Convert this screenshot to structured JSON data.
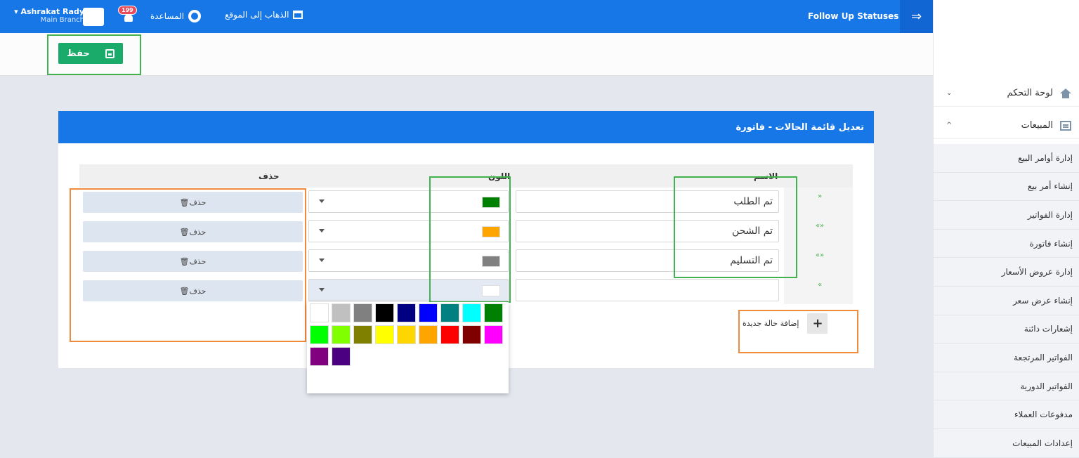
{
  "topbar": {
    "user_name": "▾ Ashrakat Rady",
    "branch": "Main Branch",
    "notif_count": "199",
    "help_label": "المساعدة",
    "goto_site_label": "الذهاب إلى الموقع",
    "page_title": "Follow Up Statuses",
    "menu_toggle": "⇒"
  },
  "actions": {
    "save_label": "حفظ"
  },
  "panel": {
    "title": "تعديل قائمة الحالات - فاتورة",
    "col_name": "الاسم",
    "col_color": "اللون",
    "col_delete": "حذف",
    "delete_label": "🗑حذف",
    "add_label": "إضافة حالة جديدة",
    "rows": [
      {
        "name": "تم الطلب",
        "color": "#008000",
        "arrows": "»"
      },
      {
        "name": "تم الشحن",
        "color": "#ffa500",
        "arrows": "«»"
      },
      {
        "name": "تم التسليم",
        "color": "#808080",
        "arrows": "«»"
      },
      {
        "name": "",
        "color": "#ffffff",
        "arrows": "«"
      }
    ]
  },
  "palette": [
    "#ffffff",
    "#c0c0c0",
    "#808080",
    "#000000",
    "#000080",
    "#0000ff",
    "#008080",
    "#00ffff",
    "#008000",
    "#00ff00",
    "#80ff00",
    "#808000",
    "#ffff00",
    "#ffd700",
    "#ffa500",
    "#ff0000",
    "#800000",
    "#ff00ff",
    "#800080",
    "#4b0082"
  ],
  "sidebar": {
    "dashboard": "لوحة التحكم",
    "sales": "المبيعات",
    "items": [
      "إدارة أوامر البيع",
      "إنشاء أمر بيع",
      "إدارة الفواتير",
      "إنشاء فاتورة",
      "إدارة عروض الأسعار",
      "إنشاء عرض سعر",
      "إشعارات دائنة",
      "الفواتير المرتجعة",
      "الفواتير الدورية",
      "مدفوعات العملاء",
      "إعدادات المبيعات"
    ]
  }
}
